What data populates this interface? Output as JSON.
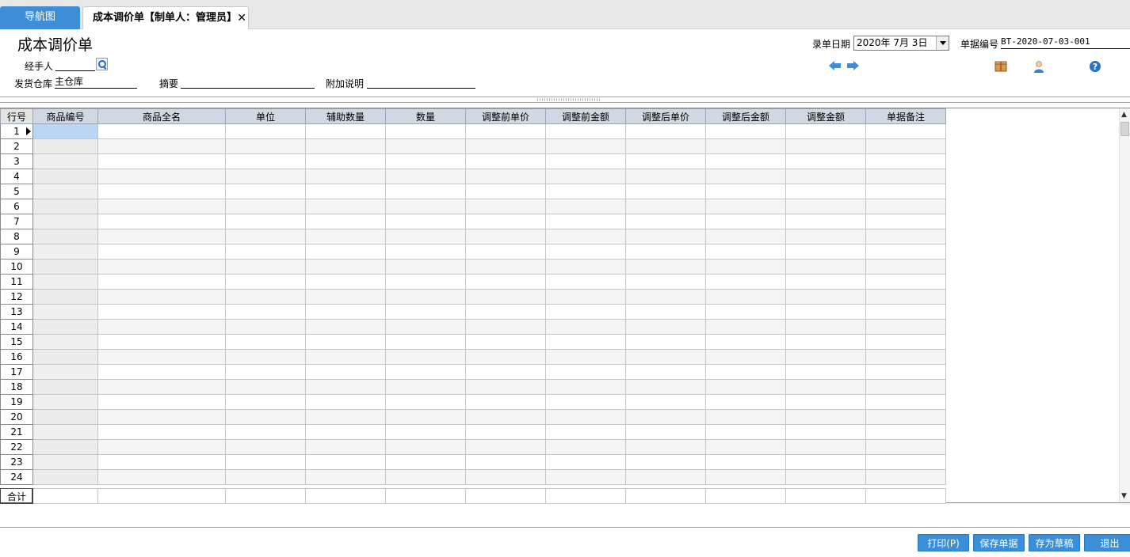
{
  "tabs": {
    "nav_label": "导航图",
    "active_label": "成本调价单【制单人：管理员】",
    "close_glyph": "✕"
  },
  "header": {
    "title": "成本调价单",
    "handler_label": "经手人",
    "handler_value": "",
    "warehouse_label": "发货仓库",
    "warehouse_value": "主仓库",
    "summary_label": "摘要",
    "summary_value": "",
    "note_label": "附加说明",
    "note_value": "",
    "date_label": "录单日期",
    "date_value": "2020年 7月 3日",
    "docno_label": "单据编号",
    "docno_value": "BT-2020-07-03-001"
  },
  "icons": {
    "prev": "arrow-left-icon",
    "next": "arrow-right-icon",
    "box": "package-icon",
    "user": "user-icon",
    "help": "help-icon",
    "search": "search-icon"
  },
  "grid": {
    "columns": [
      "行号",
      "商品编号",
      "商品全名",
      "单位",
      "辅助数量",
      "数量",
      "调整前单价",
      "调整前金额",
      "调整后单价",
      "调整后金额",
      "调整金额",
      "单据备注"
    ],
    "rows": [
      "1",
      "2",
      "3",
      "4",
      "5",
      "6",
      "7",
      "8",
      "9",
      "10",
      "11",
      "12",
      "13",
      "14",
      "15",
      "16",
      "17",
      "18",
      "19",
      "20",
      "21",
      "22",
      "23",
      "24"
    ],
    "total_label": "合计"
  },
  "footer": {
    "print_label": "打印(P)",
    "save_label": "保存单据",
    "draft_label": "存为草稿",
    "exit_label": "退出"
  },
  "colors": {
    "accent": "#3a8fd8",
    "header_bg": "#cfd8e3",
    "selected_cell": "#b9d7f5"
  }
}
